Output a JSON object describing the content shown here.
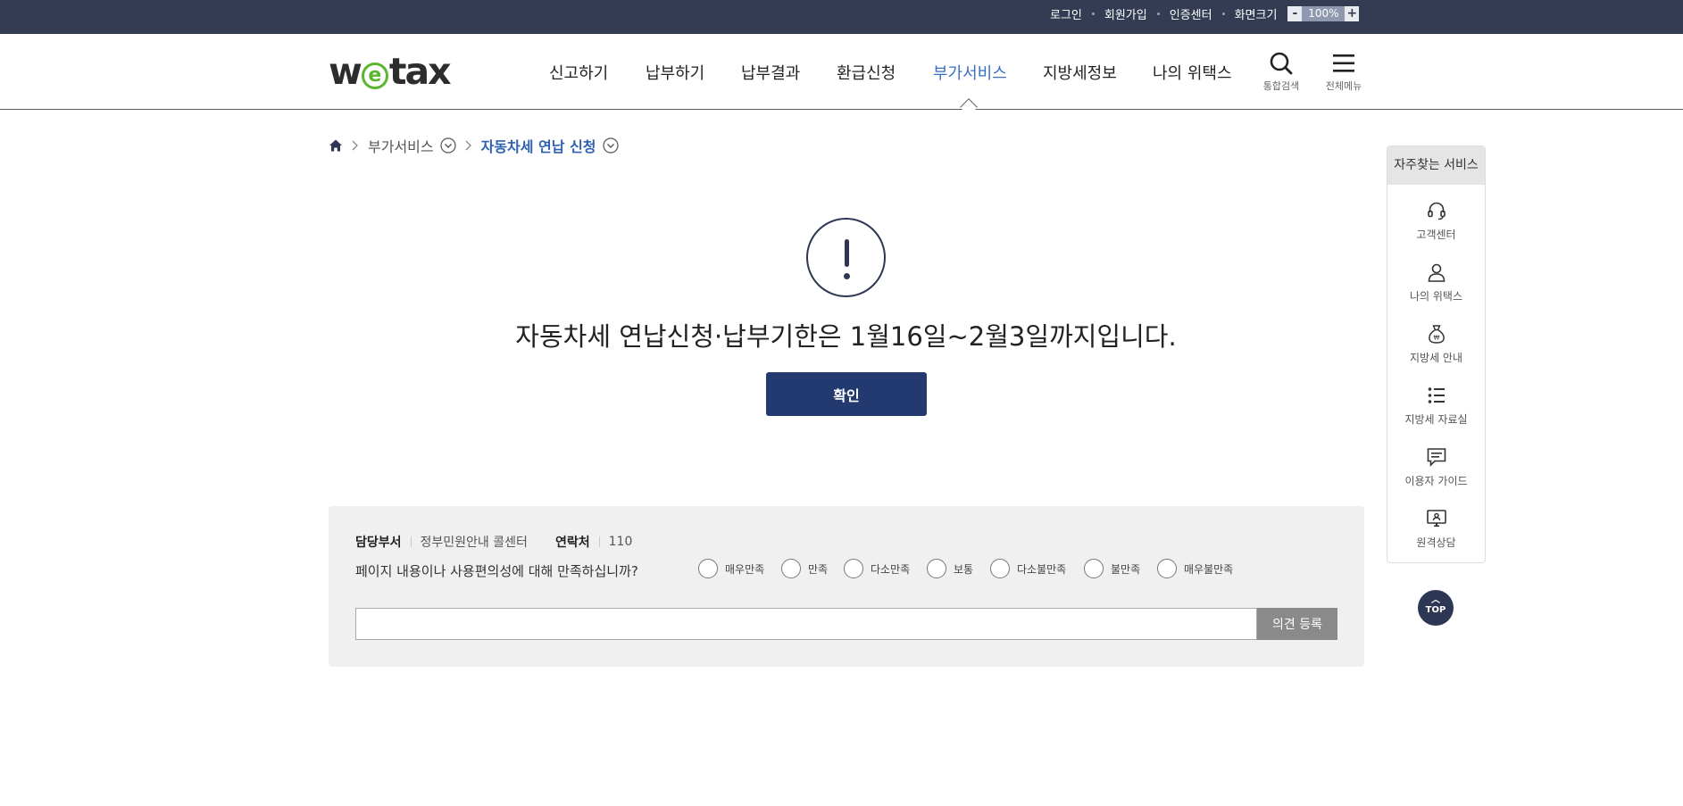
{
  "util_bar": {
    "login": "로그인",
    "signup": "회원가입",
    "cert_center": "인증센터",
    "screen_size": "화면크기",
    "zoom_minus": "-",
    "zoom_level": "100%",
    "zoom_plus": "+"
  },
  "header": {
    "logo_pre": "w",
    "logo_e": "e",
    "logo_post": "tax",
    "nav": [
      "신고하기",
      "납부하기",
      "납부결과",
      "환급신청",
      "부가서비스",
      "지방세정보",
      "나의 위택스"
    ],
    "active_nav": "부가서비스",
    "search_label": "통합검색",
    "menu_label": "전체메뉴"
  },
  "breadcrumb": {
    "level1": "부가서비스",
    "current": "자동차세 연납 신청"
  },
  "notice": {
    "message": "자동차세 연납신청·납부기한은 1월16일~2월3일까지입니다.",
    "confirm": "확인"
  },
  "survey": {
    "dept_label": "담당부서",
    "dept_value": "정부민원안내 콜센터",
    "contact_label": "연락처",
    "contact_value": "110",
    "question": "페이지 내용이나 사용편의성에 대해 만족하십니까?",
    "options": [
      "매우만족",
      "만족",
      "다소만족",
      "보통",
      "다소불만족",
      "불만족",
      "매우불만족"
    ],
    "submit": "의견 등록"
  },
  "quick_menu": {
    "title": "자주찾는 서비스",
    "items": [
      "고객센터",
      "나의 위택스",
      "지방세 안내",
      "지방세 자료실",
      "이용자 가이드",
      "원격상담"
    ]
  },
  "top_button": "TOP",
  "colors": {
    "top_bar": "#333c53",
    "primary_button": "#233a70",
    "active_nav": "#3a6fc4",
    "logo_accent": "#5cb531"
  }
}
